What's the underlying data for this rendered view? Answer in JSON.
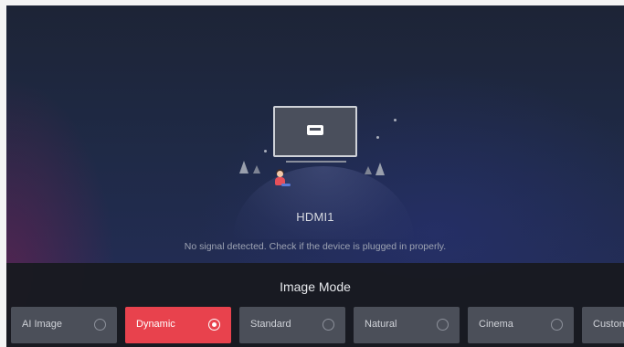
{
  "source": {
    "name": "HDMI1",
    "status_message": "No signal detected. Check if the device is plugged in properly."
  },
  "image_mode": {
    "title": "Image Mode",
    "options": [
      {
        "label": "AI Image",
        "selected": false
      },
      {
        "label": "Dynamic",
        "selected": true
      },
      {
        "label": "Standard",
        "selected": false
      },
      {
        "label": "Natural",
        "selected": false
      },
      {
        "label": "Cinema",
        "selected": false
      },
      {
        "label": "Custom",
        "selected": false
      }
    ]
  },
  "colors": {
    "selected_accent": "#e8424d",
    "option_bg": "#4b4f59",
    "panel_bg": "#181a20"
  },
  "icons": {
    "hdmi": "hdmi-port-icon",
    "radio": "radio-button-icon"
  }
}
